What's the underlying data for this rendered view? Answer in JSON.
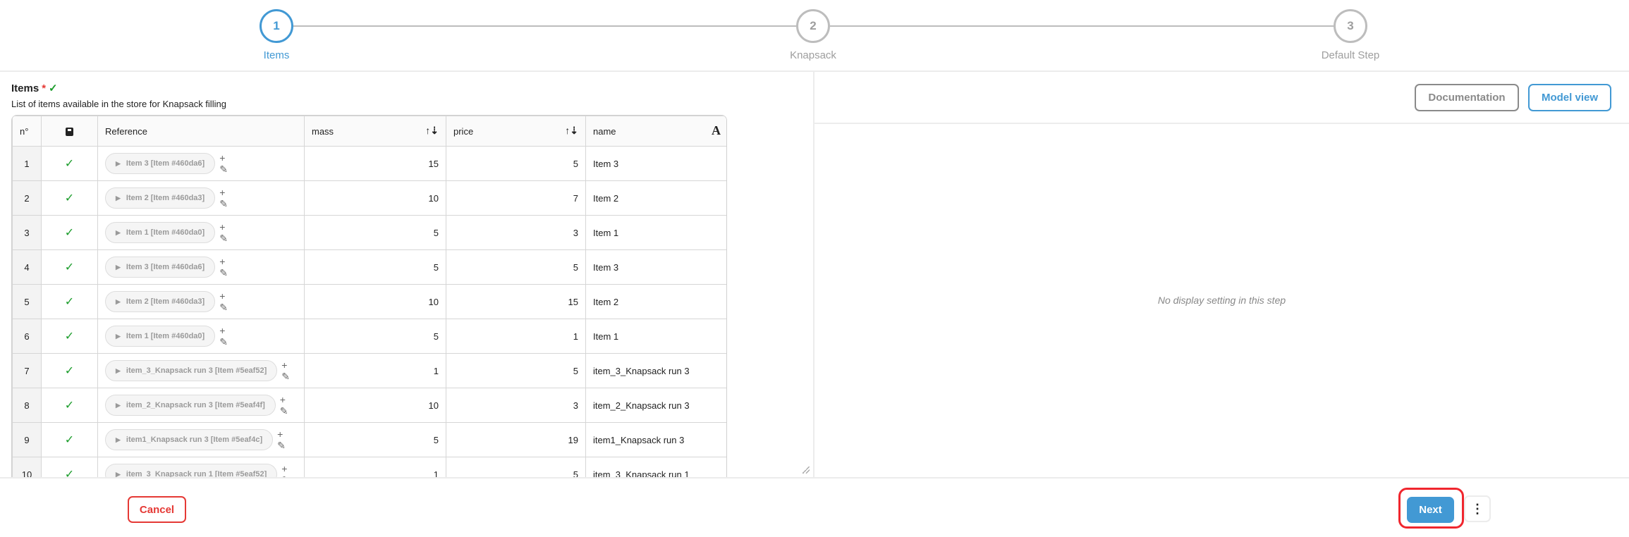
{
  "stepper": {
    "steps": [
      {
        "number": "1",
        "label": "Items",
        "active": true
      },
      {
        "number": "2",
        "label": "Knapsack",
        "active": false
      },
      {
        "number": "3",
        "label": "Default Step",
        "active": false
      }
    ]
  },
  "field": {
    "title": "Items",
    "required_mark": "*",
    "valid_mark": "✓",
    "description": "List of items available in the store for Knapsack filling"
  },
  "table": {
    "headers": {
      "index": "n°",
      "reference": "Reference",
      "mass": "mass",
      "price": "price",
      "name": "name"
    },
    "rows": [
      {
        "n": "1",
        "ref": "Item 3 [Item #460da6]",
        "mass": "15",
        "price": "5",
        "name": "Item 3"
      },
      {
        "n": "2",
        "ref": "Item 2 [Item #460da3]",
        "mass": "10",
        "price": "7",
        "name": "Item 2"
      },
      {
        "n": "3",
        "ref": "Item 1 [Item #460da0]",
        "mass": "5",
        "price": "3",
        "name": "Item 1"
      },
      {
        "n": "4",
        "ref": "Item 3 [Item #460da6]",
        "mass": "5",
        "price": "5",
        "name": "Item 3"
      },
      {
        "n": "5",
        "ref": "Item 2 [Item #460da3]",
        "mass": "10",
        "price": "15",
        "name": "Item 2"
      },
      {
        "n": "6",
        "ref": "Item 1 [Item #460da0]",
        "mass": "5",
        "price": "1",
        "name": "Item 1"
      },
      {
        "n": "7",
        "ref": "item_3_Knapsack run 3 [Item #5eaf52]",
        "mass": "1",
        "price": "5",
        "name": "item_3_Knapsack run 3"
      },
      {
        "n": "8",
        "ref": "item_2_Knapsack run 3 [Item #5eaf4f]",
        "mass": "10",
        "price": "3",
        "name": "item_2_Knapsack run 3"
      },
      {
        "n": "9",
        "ref": "item1_Knapsack run 3 [Item #5eaf4c]",
        "mass": "5",
        "price": "19",
        "name": "item1_Knapsack run 3"
      },
      {
        "n": "10",
        "ref": "item_3_Knapsack run 1 [Item #5eaf52]",
        "mass": "1",
        "price": "5",
        "name": "item_3_Knapsack run 1"
      }
    ]
  },
  "right_panel": {
    "documentation_label": "Documentation",
    "model_view_label": "Model view",
    "empty_message": "No display setting in this step"
  },
  "footer": {
    "cancel_label": "Cancel",
    "next_label": "Next",
    "more_label": "⋮"
  },
  "colors": {
    "accent": "#4299d4",
    "danger": "#e53935",
    "success": "#1a9c2a"
  }
}
